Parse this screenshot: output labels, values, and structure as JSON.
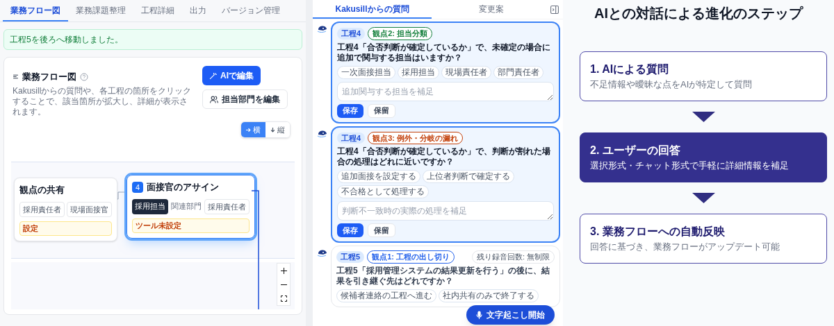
{
  "tabs": [
    {
      "label": "業務フロー図",
      "selected": true
    },
    {
      "label": "業務課題整理",
      "selected": false
    },
    {
      "label": "工程詳細",
      "selected": false
    },
    {
      "label": "出力",
      "selected": false
    },
    {
      "label": "バージョン管理",
      "selected": false
    }
  ],
  "alert": {
    "text": "工程5を後ろへ移動しました。"
  },
  "flow_card": {
    "title": "業務フロー図",
    "description": "Kakusillからの質問や、各工程の箇所をクリックすることで、該当箇所が拡大し、詳細が表示されます。",
    "buttons": [
      {
        "kind": "primary",
        "label": "AIで編集"
      },
      {
        "kind": "secondary",
        "label": "担当部門を編集"
      }
    ],
    "orientation": [
      {
        "label": "横",
        "selected": true
      },
      {
        "label": "縦",
        "selected": false
      }
    ],
    "nodes": [
      {
        "title": "観点の共有",
        "highlighted": false,
        "tags": [
          {
            "label": "採用責任者",
            "selected": false
          },
          {
            "label": "現場面接官",
            "selected": false
          }
        ],
        "warning": "設定"
      },
      {
        "number": "4",
        "title": "面接官のアサイン",
        "highlighted": true,
        "tags": [
          {
            "label": "採用担当",
            "selected": true
          },
          {
            "label": "関連部門",
            "selected": false
          },
          {
            "label": "採用責任者",
            "selected": false
          }
        ],
        "warning": "ツール未設定"
      }
    ]
  },
  "question_panel": {
    "tabs": [
      {
        "label": "Kakusillからの質問",
        "selected": true
      },
      {
        "label": "変更案",
        "selected": false
      }
    ],
    "questions": [
      {
        "active": true,
        "step": "工程4",
        "aspect": "観点2: 担当分類",
        "color": "#15803d",
        "text": "工程4「合否判断が確定しているか」で、未確定の場合に追加で関与する担当はいますか？",
        "options": [
          "一次面接担当",
          "採用担当",
          "現場責任者",
          "部門責任者"
        ],
        "placeholder": "追加関与する担当を補足",
        "buttons": [
          "保存",
          "保留"
        ]
      },
      {
        "active": true,
        "step": "工程4",
        "aspect": "観点3: 例外・分岐の漏れ",
        "color": "#c2410c",
        "text": "工程4「合否判断が確定しているか」で、判断が割れた場合の処理はどれに近いですか？",
        "options": [
          "追加面接を設定する",
          "上位者判断で確定する",
          "不合格として処理する"
        ],
        "placeholder": "判断不一致時の実際の処理を補足",
        "buttons": [
          "保存",
          "保留"
        ]
      },
      {
        "active": false,
        "step": "工程5",
        "aspect": "観点1: 工程の出し切り",
        "color": "#2563eb",
        "text": "工程5「採用管理システムの結果更新を行う」の後に、結果を引き継ぐ先はどれですか？",
        "options": [
          "候補者連絡の工程へ進む",
          "社内共有のみで終了する"
        ]
      }
    ],
    "recording_badge": "残り録音回数: 無制限",
    "transcribe_button": "文字起こし開始"
  },
  "steps_panel": {
    "title": "AIとの対話による進化のステップ",
    "steps": [
      {
        "title": "1. AIによる質問",
        "text": "不足情報や曖昧な点をAIが特定して質問",
        "selected": false
      },
      {
        "title": "2. ユーザーの回答",
        "text": "選択形式・チャット形式で手軽に詳細情報を補足",
        "selected": true
      },
      {
        "title": "3. 業務フローへの自動反映",
        "text": "回答に基づき、業務フローがアップデート可能",
        "selected": false
      }
    ]
  }
}
